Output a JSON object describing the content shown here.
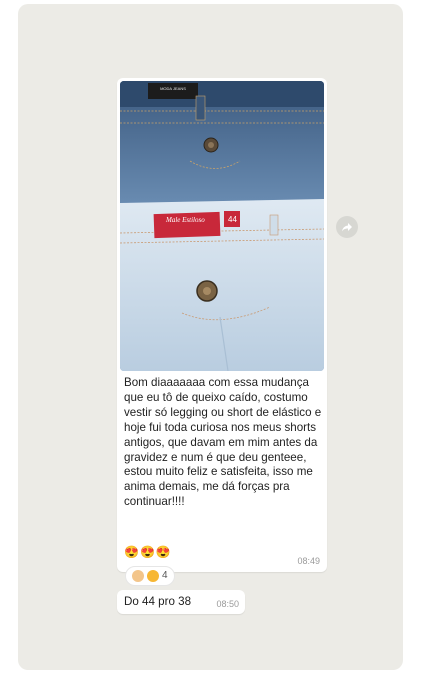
{
  "message1": {
    "text": "Bom diaaaaaaa com essa mudança que eu tô de queixo caído, costumo vestir só legging ou short de elástico e hoje fui toda curiosa nos meus shorts antigos, que davam em mim antes da gravidez e num é que deu genteee, estou muito feliz e satisfeita, isso me anima demais, me dá forças pra continuar!!!!",
    "emojis": "😍😍😍",
    "time": "08:49",
    "photo": {
      "top_label": "MODA JEANS",
      "brand": "Male Estiloso",
      "size": "44"
    }
  },
  "reactions": {
    "count": "4",
    "icons": [
      "clapping-hands-icon",
      "kiss-icon"
    ]
  },
  "message2": {
    "text": "Do 44 pro 38",
    "time": "08:50"
  },
  "colors": {
    "background": "#ecebe6",
    "bubble": "#ffffff",
    "denim_dark": "#4e6f95",
    "denim_light": "#c9d8e6",
    "label_red": "#c8283a"
  }
}
